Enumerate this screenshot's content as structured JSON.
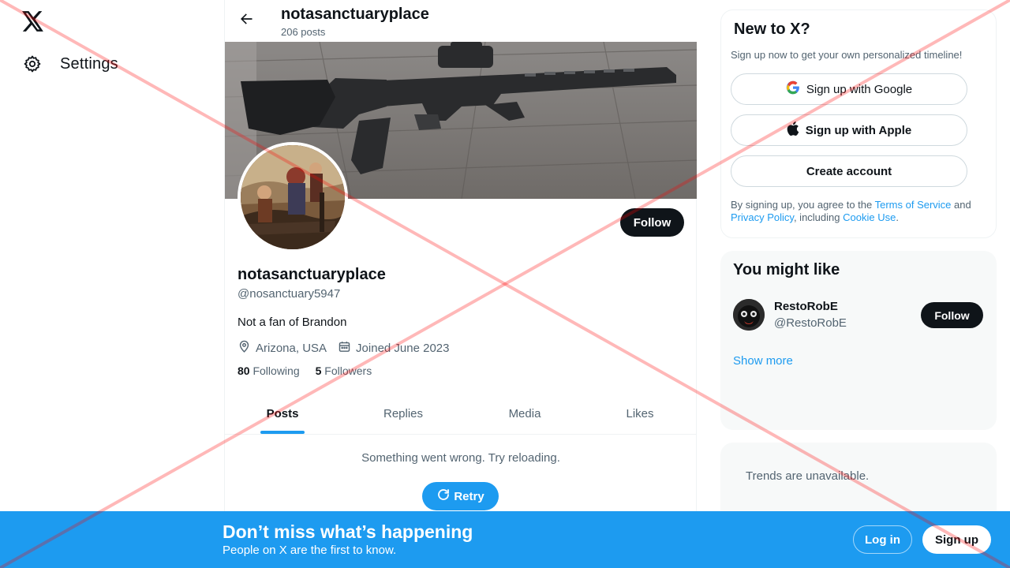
{
  "nav": {
    "logo_icon": "x-logo-icon",
    "settings_label": "Settings",
    "settings_icon": "gear-icon"
  },
  "header": {
    "back_icon": "arrow-left-icon",
    "name": "notasanctuaryplace",
    "posts_count": "206 posts"
  },
  "profile": {
    "banner": "rifle-photo",
    "avatar": "painting-avatar",
    "follow_label": "Follow",
    "name": "notasanctuaryplace",
    "handle": "@nosanctuary5947",
    "bio": "Not a fan of Brandon",
    "location": "Arizona, USA",
    "location_icon": "location-pin-icon",
    "joined": "Joined June 2023",
    "joined_icon": "calendar-icon",
    "following_count": "80",
    "following_label": "Following",
    "followers_count": "5",
    "followers_label": "Followers"
  },
  "tabs": [
    {
      "label": "Posts",
      "active": true
    },
    {
      "label": "Replies",
      "active": false
    },
    {
      "label": "Media",
      "active": false
    },
    {
      "label": "Likes",
      "active": false
    }
  ],
  "feed": {
    "error": "Something went wrong. Try reloading.",
    "retry_label": "Retry",
    "retry_icon": "refresh-icon"
  },
  "signup_card": {
    "title": "New to X?",
    "subtitle": "Sign up now to get your own personalized timeline!",
    "google_label": "Sign up with Google",
    "apple_label": "Sign up with Apple",
    "create_label": "Create account",
    "legal_prefix": "By signing up, you agree to the ",
    "terms_link": "Terms of Service",
    "legal_and": " and ",
    "privacy_link": "Privacy Policy",
    "legal_including": ", including ",
    "cookie_link": "Cookie Use",
    "legal_end": "."
  },
  "suggestions": {
    "title": "You might like",
    "items": [
      {
        "name": "RestoRobE",
        "handle": "@RestoRobE",
        "follow_label": "Follow"
      }
    ],
    "show_more": "Show more"
  },
  "trends": {
    "message": "Trends are unavailable."
  },
  "bottom_banner": {
    "title": "Don’t miss what’s happening",
    "subtitle": "People on X are the first to know.",
    "login_label": "Log in",
    "signup_label": "Sign up"
  },
  "colors": {
    "accent": "#1d9bf0",
    "primary_text": "#0f1419",
    "secondary_text": "#536471",
    "overlay_cross": "#ff0000"
  }
}
